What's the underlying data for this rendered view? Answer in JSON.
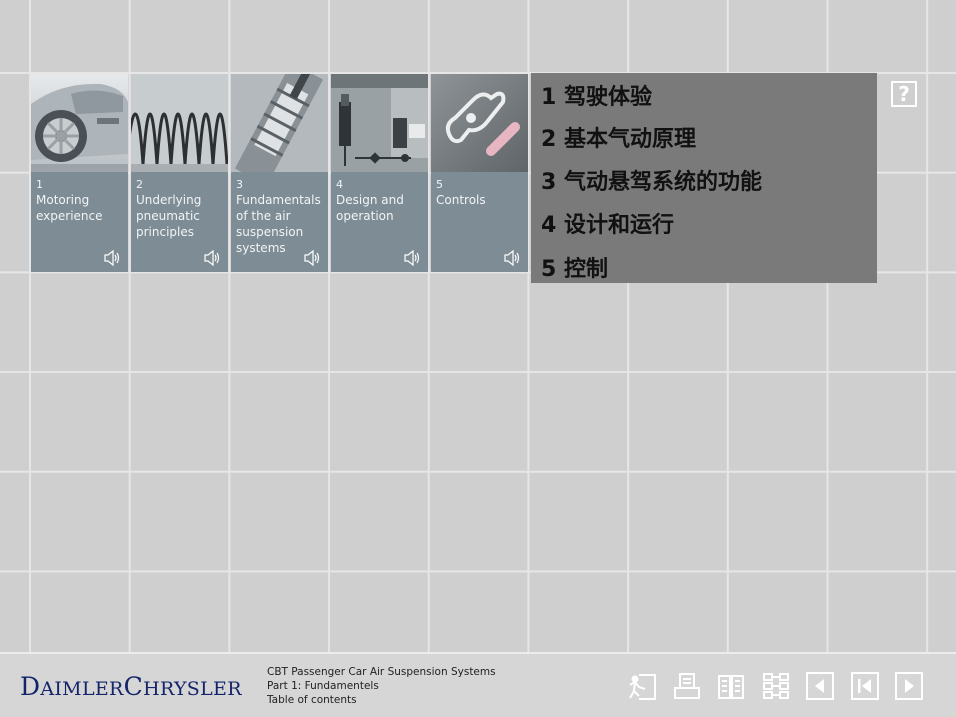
{
  "help": {
    "label": "?"
  },
  "modules": [
    {
      "number": "1",
      "title": "Motoring experience",
      "thumbnail": "car-photo"
    },
    {
      "number": "2",
      "title": "Underlying pneumatic principles",
      "thumbnail": "spring-photo"
    },
    {
      "number": "3",
      "title": "Fundamentals of the air suspension systems",
      "thumbnail": "air-strut-photo"
    },
    {
      "number": "4",
      "title": "Design and operation",
      "thumbnail": "schematic-photo"
    },
    {
      "number": "5",
      "title": "Controls",
      "thumbnail": "controls-switch-photo"
    }
  ],
  "overlay": {
    "items": [
      "1 驾驶体验",
      "2 基本气动原理",
      "3 气动悬驾系统的功能",
      "4 设计和运行",
      "5 控制"
    ]
  },
  "footer": {
    "logo": {
      "part1_initial": "D",
      "part1_rest": "AIMLER",
      "part2_initial": "C",
      "part2_rest": "HRYSLER"
    },
    "course_title": "CBT Passenger Car Air Suspension Systems",
    "part": "Part 1: Fundamentels",
    "page": "Table of contents"
  },
  "nav_icons": [
    "exit-icon",
    "print-icon",
    "glossary-icon",
    "sitemap-icon",
    "previous-icon",
    "first-page-icon",
    "next-icon"
  ],
  "colors": {
    "background": "#cfcfcf",
    "grid": "#e6e6e6",
    "caption": "#7d8c95",
    "overlay": "#7a7a7a",
    "logo": "#14246a"
  }
}
